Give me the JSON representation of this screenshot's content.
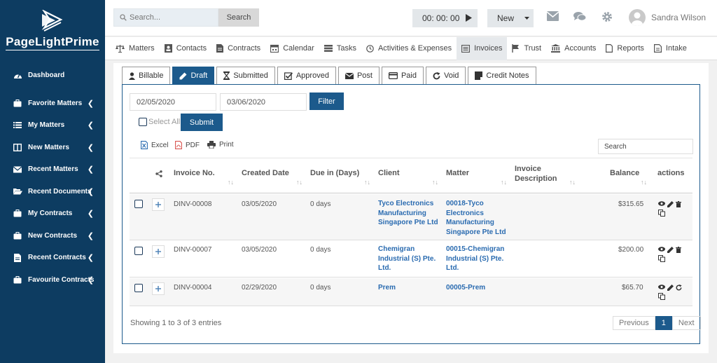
{
  "brand": {
    "name": "PageLightPrime"
  },
  "sidebar": {
    "items": [
      {
        "label": "Dashboard",
        "icon": "dashboard-icon",
        "has_chevron": false
      },
      {
        "label": "Favorite Matters",
        "icon": "briefcase-icon",
        "has_chevron": true
      },
      {
        "label": "My Matters",
        "icon": "list-icon",
        "has_chevron": true
      },
      {
        "label": "New Matters",
        "icon": "columns-icon",
        "has_chevron": true
      },
      {
        "label": "Recent Matters",
        "icon": "envelope-icon",
        "has_chevron": true
      },
      {
        "label": "Recent Documents",
        "icon": "folder-open-icon",
        "has_chevron": true
      },
      {
        "label": "My Contracts",
        "icon": "briefcase-icon",
        "has_chevron": true
      },
      {
        "label": "New Contracts",
        "icon": "briefcase-icon",
        "has_chevron": true
      },
      {
        "label": "Recent Contracts",
        "icon": "file-icon",
        "has_chevron": true
      },
      {
        "label": "Favourite Contracts",
        "icon": "briefcase-icon",
        "has_chevron": true
      }
    ]
  },
  "topbar": {
    "search_placeholder": "Search...",
    "search_button": "Search",
    "timer": "00: 00: 00",
    "new_button": "New",
    "user_name": "Sandra Wilson"
  },
  "modules": [
    {
      "label": "Matters",
      "icon": "scale-icon"
    },
    {
      "label": "Contacts",
      "icon": "contact-card-icon"
    },
    {
      "label": "Contracts",
      "icon": "contract-file-icon"
    },
    {
      "label": "Calendar",
      "icon": "calendar-icon"
    },
    {
      "label": "Tasks",
      "icon": "tasks-icon"
    },
    {
      "label": "Activities & Expenses",
      "icon": "clock-icon"
    },
    {
      "label": "Invoices",
      "icon": "invoice-icon",
      "active": true
    },
    {
      "label": "Trust",
      "icon": "flag-icon"
    },
    {
      "label": "Accounts",
      "icon": "bank-icon"
    },
    {
      "label": "Reports",
      "icon": "report-file-icon"
    },
    {
      "label": "Intake",
      "icon": "intake-icon"
    }
  ],
  "tabs": [
    {
      "label": "Billable",
      "icon": "user-icon"
    },
    {
      "label": "Draft",
      "icon": "pencil-icon",
      "active": true
    },
    {
      "label": "Submitted",
      "icon": "hourglass-icon"
    },
    {
      "label": "Approved",
      "icon": "check-square-icon"
    },
    {
      "label": "Post",
      "icon": "envelope-icon"
    },
    {
      "label": "Paid",
      "icon": "credit-card-icon"
    },
    {
      "label": "Void",
      "icon": "refresh-icon"
    },
    {
      "label": "Credit Notes",
      "icon": "note-icon"
    }
  ],
  "filter": {
    "date_from": "02/05/2020",
    "date_to": "03/06/2020",
    "filter_button": "Filter",
    "select_all": "Select All",
    "submit_button": "Submit"
  },
  "exports": {
    "excel": "Excel",
    "pdf": "PDF",
    "print": "Print"
  },
  "table": {
    "search_label": "Search",
    "headers": {
      "invoice_no": "Invoice No.",
      "created_date": "Created Date",
      "due_in": "Due in (Days)",
      "client": "Client",
      "matter": "Matter",
      "invoice_description": "Invoice Description",
      "balance": "Balance",
      "actions": "actions"
    },
    "rows": [
      {
        "invoice_no": "DINV-00008",
        "created_date": "03/05/2020",
        "due_in": "0 days",
        "client": "Tyco Electronics Manufacturing Singapore Pte Ltd",
        "matter": "00018-Tyco Electronics Manufacturing Singapore Pte Ltd",
        "description": "",
        "balance": "$315.65"
      },
      {
        "invoice_no": "DINV-00007",
        "created_date": "03/05/2020",
        "due_in": "0 days",
        "client": "Chemigran Industrial (S) Pte. Ltd.",
        "matter": "00015-Chemigran Industrial (S) Pte. Ltd.",
        "description": "",
        "balance": "$200.00"
      },
      {
        "invoice_no": "DINV-00004",
        "created_date": "02/29/2020",
        "due_in": "0 days",
        "client": "Prem",
        "matter": "00005-Prem",
        "description": "",
        "balance": "$65.70"
      }
    ]
  },
  "footer": {
    "info": "Showing 1 to 3 of 3 entries",
    "previous": "Previous",
    "current_page": "1",
    "next": "Next"
  },
  "colors": {
    "sidebar": "#0d3c61",
    "accent": "#1c5a8c",
    "link": "#2a6bb0"
  }
}
